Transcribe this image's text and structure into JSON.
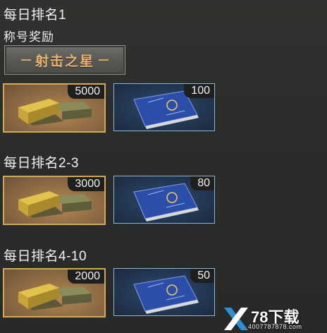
{
  "sections": [
    {
      "title": "每日排名1",
      "subtitle": "称号奖励",
      "badge": "射击之星",
      "rewards": [
        {
          "icon": "gold-bars-icon",
          "quantity": "5000"
        },
        {
          "icon": "blue-certificate-book-icon",
          "quantity": "100"
        }
      ]
    },
    {
      "title": "每日排名2-3",
      "rewards": [
        {
          "icon": "gold-bars-icon",
          "quantity": "3000"
        },
        {
          "icon": "blue-certificate-book-icon",
          "quantity": "80"
        }
      ]
    },
    {
      "title": "每日排名4-10",
      "rewards": [
        {
          "icon": "gold-bars-icon",
          "quantity": "2000"
        },
        {
          "icon": "blue-certificate-book-icon",
          "quantity": "50"
        }
      ]
    }
  ],
  "watermark": {
    "brand": "78下载",
    "site": "4007787878.com"
  },
  "colors": {
    "gold_border": "#cfa85a",
    "card_border": "#8fb4d9",
    "badge_text": "#e5b577",
    "watermark_accent": "#2f8fd6"
  }
}
